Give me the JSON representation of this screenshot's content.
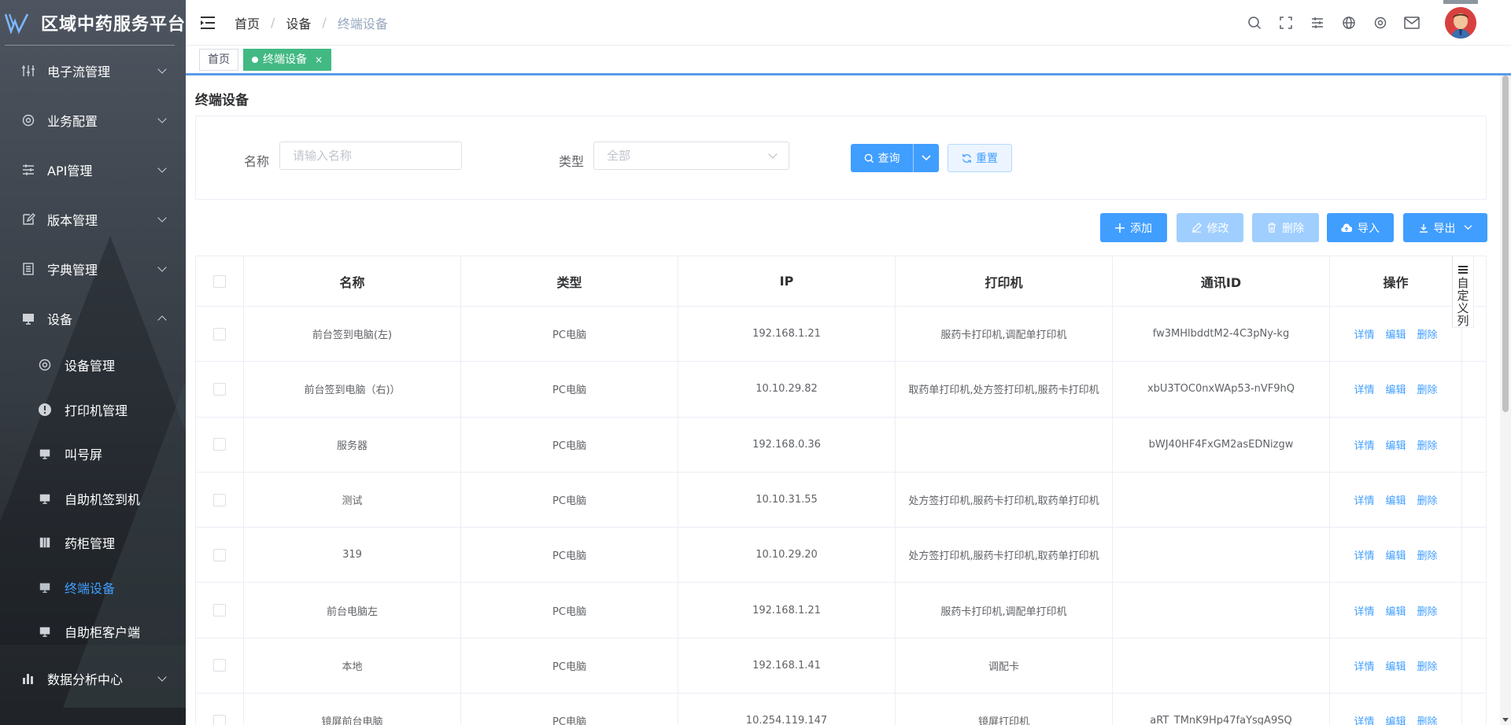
{
  "app": {
    "title": "区域中药服务平台"
  },
  "sidebar": {
    "items": [
      {
        "label": "电子流管理",
        "icon": "sliders-icon"
      },
      {
        "label": "业务配置",
        "icon": "gear-icon"
      },
      {
        "label": "API管理",
        "icon": "settings-lines-icon"
      },
      {
        "label": "版本管理",
        "icon": "edit-icon"
      },
      {
        "label": "字典管理",
        "icon": "list-icon"
      },
      {
        "label": "设备",
        "icon": "monitor-icon",
        "expanded": true
      }
    ],
    "sub_items": [
      {
        "label": "设备管理",
        "icon": "gear-icon"
      },
      {
        "label": "打印机管理",
        "icon": "alert-circle-icon"
      },
      {
        "label": "叫号屏",
        "icon": "monitor-icon"
      },
      {
        "label": "自助机签到机",
        "icon": "monitor-icon"
      },
      {
        "label": "药柜管理",
        "icon": "cabinet-icon"
      },
      {
        "label": "终端设备",
        "icon": "monitor-icon",
        "active": true
      },
      {
        "label": "自助柜客户端",
        "icon": "monitor-icon"
      }
    ],
    "last_item": {
      "label": "数据分析中心",
      "icon": "bar-chart-icon"
    }
  },
  "header": {
    "breadcrumb": [
      "首页",
      "设备",
      "终端设备"
    ],
    "separator": "/"
  },
  "tags": {
    "home": "首页",
    "active": "终端设备",
    "close": "×"
  },
  "page": {
    "title": "终端设备"
  },
  "search": {
    "name_label": "名称",
    "name_placeholder": "请输入名称",
    "type_label": "类型",
    "type_value": "全部",
    "query_label": "查询",
    "reset_label": "重置"
  },
  "toolbar": {
    "add": "添加",
    "edit": "修改",
    "delete": "删除",
    "import": "导入",
    "export": "导出"
  },
  "table": {
    "columns": [
      "名称",
      "类型",
      "IP",
      "打印机",
      "通讯ID",
      "操作"
    ],
    "actions": [
      "详情",
      "编辑",
      "删除"
    ],
    "rows": [
      {
        "name": "前台签到电脑(左)",
        "type": "PC电脑",
        "ip": "192.168.1.21",
        "printer": "服药卡打印机,调配单打印机",
        "cid": "fw3MHlbddtM2-4C3pNy-kg"
      },
      {
        "name": "前台签到电脑（右)）",
        "type": "PC电脑",
        "ip": "10.10.29.82",
        "printer": "取药单打印机,处方签打印机,服药卡打印机",
        "cid": "xbU3TOC0nxWAp53-nVF9hQ"
      },
      {
        "name": "服务器",
        "type": "PC电脑",
        "ip": "192.168.0.36",
        "printer": "",
        "cid": "bWJ40HF4FxGM2asEDNizgw"
      },
      {
        "name": "测试",
        "type": "PC电脑",
        "ip": "10.10.31.55",
        "printer": "处方签打印机,服药卡打印机,取药单打印机",
        "cid": ""
      },
      {
        "name": "319",
        "type": "PC电脑",
        "ip": "10.10.29.20",
        "printer": "处方签打印机,服药卡打印机,取药单打印机",
        "cid": ""
      },
      {
        "name": "前台电脑左",
        "type": "PC电脑",
        "ip": "192.168.1.21",
        "printer": "服药卡打印机,调配单打印机",
        "cid": ""
      },
      {
        "name": "本地",
        "type": "PC电脑",
        "ip": "192.168.1.41",
        "printer": "调配卡",
        "cid": ""
      },
      {
        "name": "镜屏前台电脑",
        "type": "PC电脑",
        "ip": "10.254.119.147",
        "printer": "镜屏打印机",
        "cid": "aRT_TMnK9Hp47faYsgA9SQ"
      }
    ]
  },
  "custom_columns": {
    "label": "自定义列"
  },
  "colors": {
    "primary": "#409eff",
    "primary_disabled": "#a0cfff",
    "tag_active": "#42b983",
    "sidebar_active": "#409eff"
  }
}
